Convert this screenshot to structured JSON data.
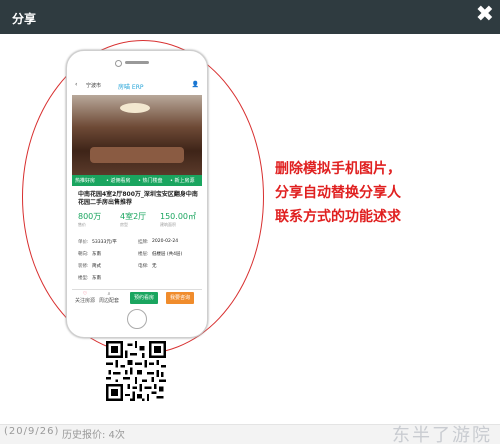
{
  "dialog": {
    "title": "分享",
    "close_glyph": "✖"
  },
  "footer": {
    "date": "(20/9/26)",
    "history": "历史报价: 4次",
    "watermark": "东半了游院"
  },
  "phone": {
    "nav": {
      "back": "‹",
      "city": "宁波市",
      "app": "房喵 ERP",
      "user": "👤"
    },
    "tags": [
      "热推好房",
      "• 返佣看房",
      "• 热门楼盘",
      "• 新上房源"
    ],
    "title": "中南花园4室2厅800万_深圳宝安区翻身中南花园二手房出售推荐",
    "stats": [
      {
        "value": "800万",
        "label": "售价"
      },
      {
        "value": "4室2厅",
        "label": "房型"
      },
      {
        "value": "150.00㎡",
        "label": "建筑面积"
      }
    ],
    "details": [
      {
        "k1": "单价:",
        "v1": "53333元/平",
        "k2": "挂牌:",
        "v2": "2020-02-24"
      },
      {
        "k1": "朝向:",
        "v1": "东南",
        "k2": "楼层:",
        "v2": "低楼层 (共4层)"
      },
      {
        "k1": "装修:",
        "v1": "简式",
        "k2": "电梯:",
        "v2": "无"
      },
      {
        "k1": "楼型:",
        "v1": "东南",
        "k2": "",
        "v2": ""
      }
    ],
    "actions": {
      "follow": "关注房源",
      "nearby": "周边配套",
      "reserve": "预约看房",
      "call": "我要咨询"
    }
  },
  "annotation": [
    "删除模拟手机图片，",
    "分享自动替换分享人",
    "联系方式的功能述求"
  ],
  "colors": {
    "titlebar": "#2f3b40",
    "accent_green": "#1aa55f",
    "annotation_red": "#e02020",
    "reserve_btn": "#1aa55f",
    "call_btn": "#f08c2c"
  }
}
